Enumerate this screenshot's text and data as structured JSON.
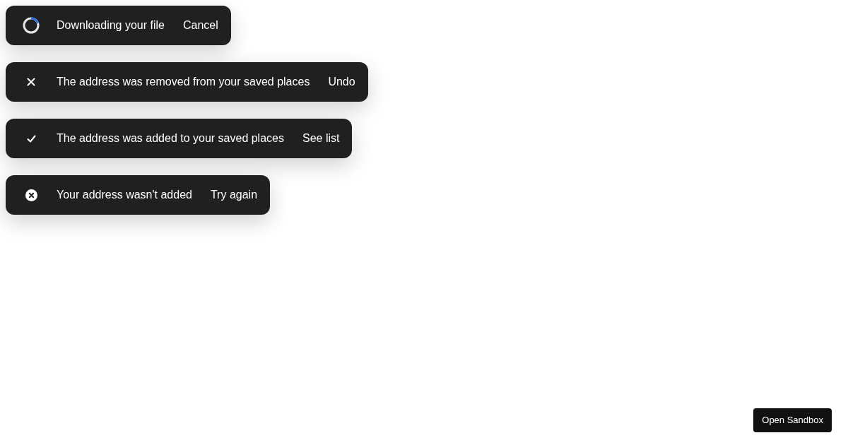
{
  "toasts": [
    {
      "kind": "loading",
      "message": "Downloading your file",
      "action": "Cancel"
    },
    {
      "kind": "removed",
      "message": "The address was removed from your saved places",
      "action": "Undo"
    },
    {
      "kind": "added",
      "message": "The address was added to your saved places",
      "action": "See list"
    },
    {
      "kind": "error",
      "message": "Your address wasn't added",
      "action": "Try again"
    }
  ],
  "sandbox_button": "Open Sandbox"
}
